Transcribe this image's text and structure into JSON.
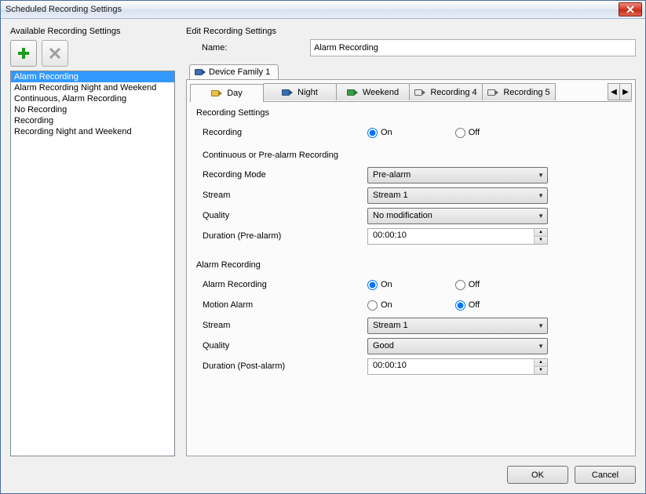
{
  "window": {
    "title": "Scheduled Recording Settings"
  },
  "left": {
    "heading": "Available Recording Settings",
    "items": [
      "Alarm Recording",
      "Alarm Recording Night and Weekend",
      "Continuous, Alarm Recording",
      "No Recording",
      "Recording",
      "Recording Night and Weekend"
    ],
    "selected_index": 0
  },
  "right": {
    "heading": "Edit Recording Settings",
    "name_label": "Name:",
    "name_value": "Alarm Recording",
    "device_tab": "Device Family 1",
    "schedule_tabs": [
      "Day",
      "Night",
      "Weekend",
      "Recording 4",
      "Recording 5"
    ],
    "form": {
      "group_recording_settings": "Recording Settings",
      "recording_label": "Recording",
      "on_label": "On",
      "off_label": "Off",
      "recording_value": "On",
      "group_continuous": "Continuous or Pre-alarm Recording",
      "recording_mode_label": "Recording Mode",
      "recording_mode_value": "Pre-alarm",
      "stream_label": "Stream",
      "stream_value": "Stream 1",
      "quality_label": "Quality",
      "quality_value": "No modification",
      "duration_pre_label": "Duration (Pre-alarm)",
      "duration_pre_value": "00:00:10",
      "group_alarm": "Alarm Recording",
      "alarm_recording_label": "Alarm Recording",
      "alarm_recording_value": "On",
      "motion_alarm_label": "Motion Alarm",
      "motion_alarm_value": "Off",
      "alarm_stream_label": "Stream",
      "alarm_stream_value": "Stream 1",
      "alarm_quality_label": "Quality",
      "alarm_quality_value": "Good",
      "duration_post_label": "Duration (Post-alarm)",
      "duration_post_value": "00:00:10"
    }
  },
  "buttons": {
    "ok": "OK",
    "cancel": "Cancel"
  }
}
